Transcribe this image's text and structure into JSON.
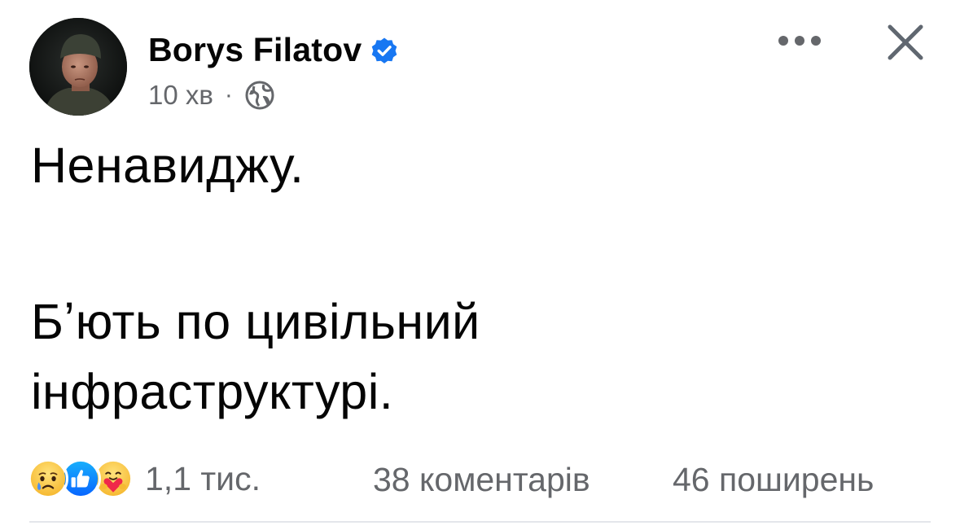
{
  "post": {
    "author": {
      "name": "Borys Filatov",
      "verified": true,
      "avatar": "author-avatar"
    },
    "time": "10 хв",
    "separator": "·",
    "privacy_icon": "globe-icon",
    "menu_icon": "more-horizontal-icon",
    "close_icon": "close-icon",
    "text_lines": [
      "Ненавиджу.",
      "Бʼють по цивільний",
      "інфраструктурі."
    ],
    "reactions": {
      "icons": [
        "sad-reaction-icon",
        "like-reaction-icon",
        "care-reaction-icon"
      ],
      "count": "1,1 тис."
    },
    "comments": "38 коментарів",
    "shares": "46 поширень"
  },
  "colors": {
    "text": "#050505",
    "secondary": "#65676b",
    "facebook_blue": "#1877f2",
    "divider": "#e4e6eb"
  }
}
